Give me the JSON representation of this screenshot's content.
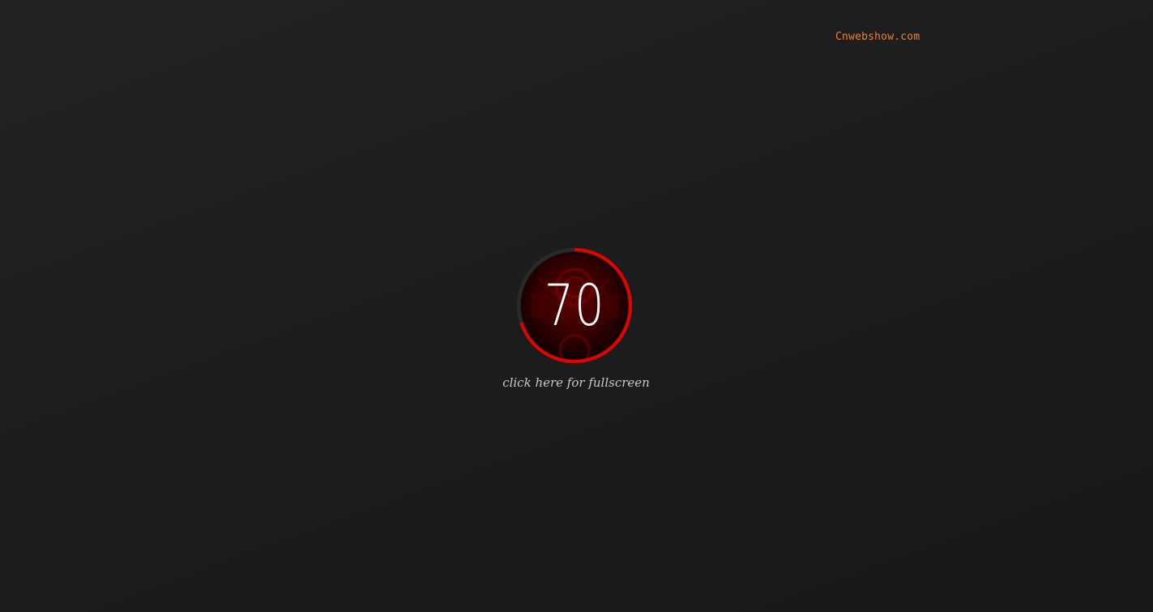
{
  "site": {
    "label": "Cnwebshow.com",
    "color": "#e8823a"
  },
  "loader": {
    "progress_text": "70",
    "progress_fraction": 0.7,
    "ring_color": "#e60000",
    "track_color": "#2a2a2a",
    "inner_color": "#3d0000"
  },
  "fullscreen": {
    "label": "click here for fullscreen"
  }
}
